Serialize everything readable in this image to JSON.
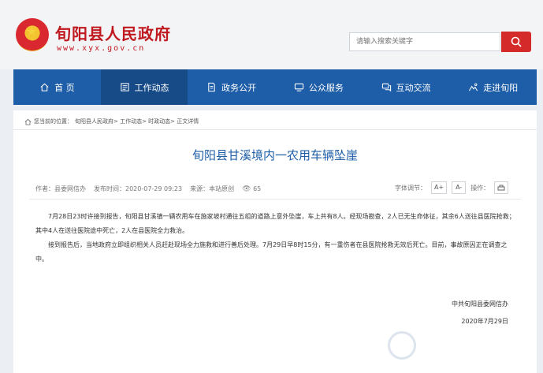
{
  "header": {
    "site_title": "旬阳县人民政府",
    "site_url": "www.xyx.gov.cn",
    "search_placeholder": "请输入搜索关键字"
  },
  "nav": [
    {
      "label": "首 页",
      "icon": "home-icon"
    },
    {
      "label": "工作动态",
      "icon": "document-icon",
      "active": true
    },
    {
      "label": "政务公开",
      "icon": "file-icon"
    },
    {
      "label": "公众服务",
      "icon": "monitor-icon"
    },
    {
      "label": "互动交流",
      "icon": "chat-icon"
    },
    {
      "label": "走进旬阳",
      "icon": "landscape-icon"
    }
  ],
  "breadcrumb": {
    "prefix": "您当前的位置：",
    "path": "旬阳县人民政府> 工作动态> 时政动态> 正文详情"
  },
  "article": {
    "title": "旬阳县甘溪境内一农用车辆坠崖",
    "author": "作者：县委网信办",
    "publish_time": "发布时间：2020-07-29 09:23",
    "source": "来源：本站原创",
    "views": "65",
    "font_size_label": "字体调节：",
    "font_increase": "A+",
    "font_decrease": "A-",
    "operate_label": "操作：",
    "paragraphs": [
      "7月28日23时许接到报告，旬阳县甘溪镇一辆农用车在施家坡村通往五组的道路上意外坠崖，车上共有8人。经现场勘查，2人已无生命体征，其余6人送往县医院抢救；其中4人在送往医院途中死亡，2人在县医院全力救治。",
      "接到报告后，当地政府立即组织相关人员赶赴现场全力施救和进行善后处理。7月29日早8时15分，有一重伤者在县医院抢救无效后死亡。目前，事故原因正在调查之中。"
    ],
    "signature": "中共旬阳县委网信办",
    "date": "2020年7月29日"
  },
  "colors": {
    "brand_red": "#c0181f",
    "nav_blue": "#1e5ea8",
    "search_red": "#d52a2a"
  }
}
